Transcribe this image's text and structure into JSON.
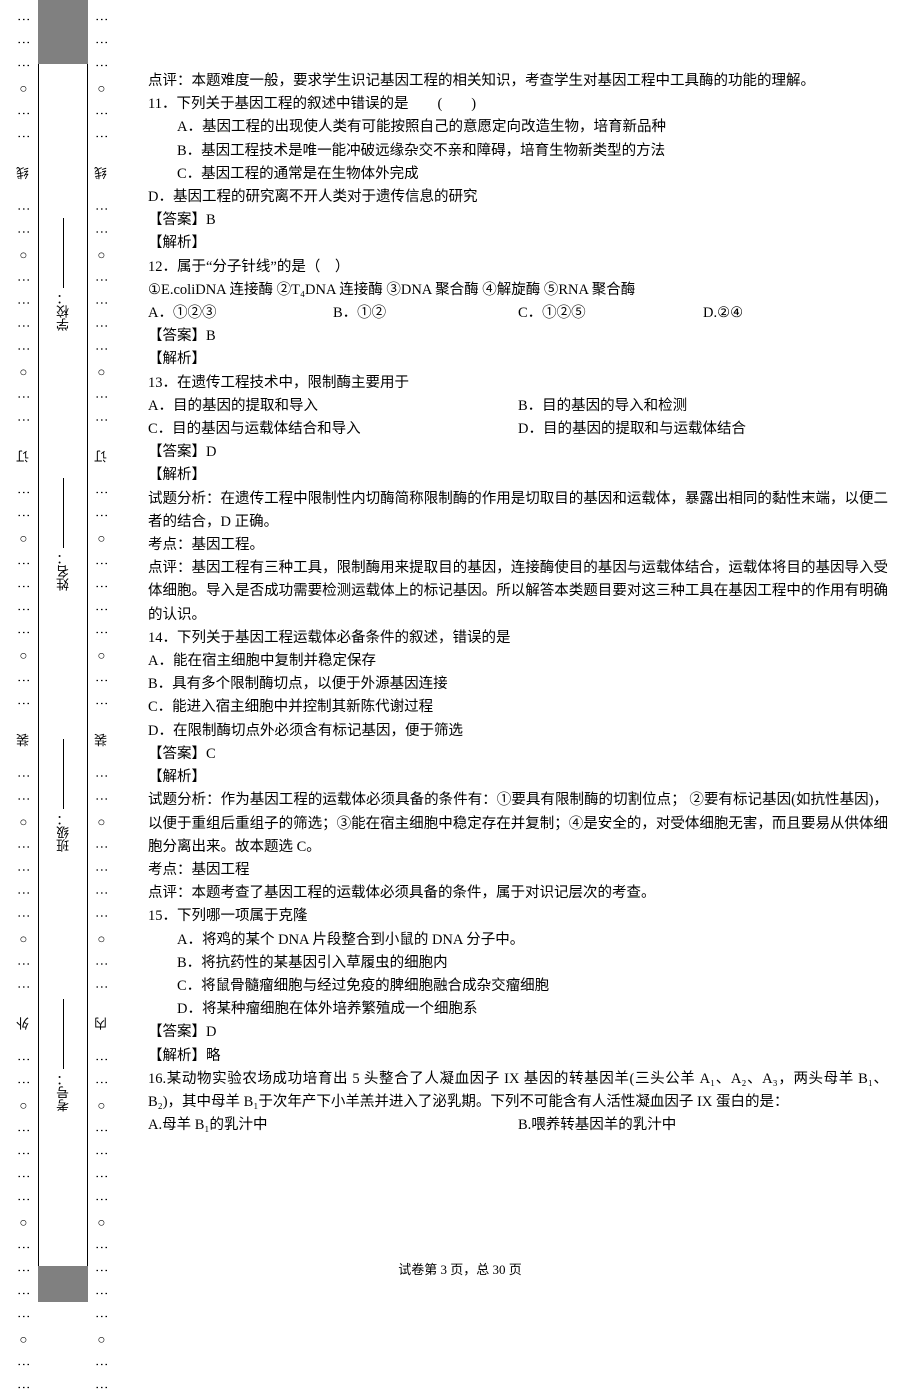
{
  "margin": {
    "outer": "⋮⋮○⋮⋮⋮⋮○⋮⋮⋮⋮○⋮⋮ 外 ⋮⋮○⋮⋮⋮⋮○⋮⋮ 装 ⋮⋮○⋮⋮⋮⋮○⋮⋮ 订 ⋮⋮○⋮⋮⋮⋮○⋮⋮ 线 ⋮⋮○⋮⋮⋮⋮○⋮⋮",
    "inner": "⋮⋮○⋮⋮⋮⋮○⋮⋮⋮⋮○⋮⋮ 内 ⋮⋮○⋮⋮⋮⋮○⋮⋮ 装 ⋮⋮○⋮⋮⋮⋮○⋮⋮ 订 ⋮⋮○⋮⋮⋮⋮○⋮⋮ 线 ⋮⋮○⋮⋮⋮⋮○⋮⋮",
    "fields": {
      "school": "学校：",
      "name": "姓名：",
      "class": "班级：",
      "examno": "考号："
    }
  },
  "body": {
    "p_comment_top": "点评：本题难度一般，要求学生识记基因工程的相关知识，考查学生对基因工程中工具酶的功能的理解。",
    "q11": {
      "stem": "11．下列关于基因工程的叙述中错误的是　　(　　)",
      "a": "A．基因工程的出现使人类有可能按照自己的意愿定向改造生物，培育新品种",
      "b": "B．基因工程技术是唯一能冲破远缘杂交不亲和障碍，培育生物新类型的方法",
      "c": "C．基因工程的通常是在生物体外完成",
      "d": "D．基因工程的研究离不开人类对于遗传信息的研究",
      "ans": "【答案】B",
      "exp": "【解析】"
    },
    "q12": {
      "stem": "12．属于“分子针线”的是（　）",
      "line2": "①E.coliDNA 连接酶  ②T₄DNA 连接酶  ③DNA 聚合酶  ④解旋酶  ⑤RNA 聚合酶",
      "a": "A．①②③",
      "b": "B．①②",
      "c": "C．①②⑤",
      "d": "D.②④",
      "ans": "【答案】B",
      "exp": "【解析】"
    },
    "q13": {
      "stem": "13．在遗传工程技术中，限制酶主要用于",
      "a": "A．目的基因的提取和导入",
      "b": "B．目的基因的导入和检测",
      "c": "C．目的基因与运载体结合和导入",
      "d": "D．目的基因的提取和与运载体结合",
      "ans": "【答案】D",
      "exp": "【解析】",
      "ana1": "试题分析：在遗传工程中限制性内切酶简称限制酶的作用是切取目的基因和运载体，暴露出相同的黏性末端，以便二者的结合，D 正确。",
      "kd": "考点：基因工程。",
      "cmt": "点评：基因工程有三种工具，限制酶用来提取目的基因，连接酶使目的基因与运载体结合，运载体将目的基因导入受体细胞。导入是否成功需要检测运载体上的标记基因。所以解答本类题目要对这三种工具在基因工程中的作用有明确的认识。"
    },
    "q14": {
      "stem": "14．下列关于基因工程运载体必备条件的叙述，错误的是",
      "a": "A．能在宿主细胞中复制并稳定保存",
      "b": "B．具有多个限制酶切点，以便于外源基因连接",
      "c": "C．能进入宿主细胞中并控制其新陈代谢过程",
      "d": "D．在限制酶切点外必须含有标记基因，便于筛选",
      "ans": "【答案】C",
      "exp": "【解析】",
      "ana1": "试题分析：作为基因工程的运载体必须具备的条件有：①要具有限制酶的切割位点；  ②要有标记基因(如抗性基因)，以便于重组后重组子的筛选；③能在宿主细胞中稳定存在并复制；④是安全的，对受体细胞无害，而且要易从供体细胞分离出来。故本题选 C。",
      "kd": "考点：基因工程",
      "cmt": "点评：本题考查了基因工程的运载体必须具备的条件，属于对识记层次的考查。"
    },
    "q15": {
      "stem": "15．下列哪一项属于克隆",
      "a": "A．将鸡的某个 DNA 片段整合到小鼠的 DNA 分子中。",
      "b": "B．将抗药性的某基因引入草履虫的细胞内",
      "c": "C．将鼠骨髓瘤细胞与经过免疫的脾细胞融合成杂交瘤细胞",
      "d": "D．将某种瘤细胞在体外培养繁殖成一个细胞系",
      "ans": "【答案】D",
      "exp": "【解析】略"
    },
    "q16": {
      "stem": "16.某动物实验农场成功培育出 5 头整合了人凝血因子 IX 基因的转基因羊(三头公羊 A₁、A₂、A₃，两头母羊 B₁、B₂)，其中母羊 B₁于次年产下小羊羔并进入了泌乳期。下列不可能含有人活性凝血因子 IX 蛋白的是：",
      "a": "A.母羊 B₁的乳汁中",
      "b": "B.喂养转基因羊的乳汁中"
    }
  },
  "footer": "试卷第 3 页，总 30 页"
}
